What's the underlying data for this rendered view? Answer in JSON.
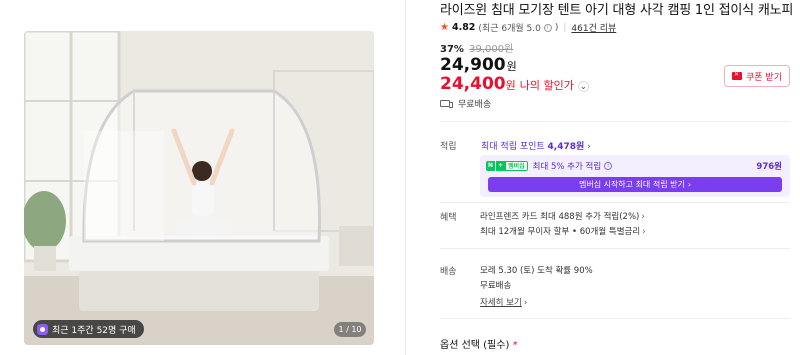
{
  "gallery": {
    "buy_badge": "최근 1주간 52명 구매",
    "pager": "1 / 10"
  },
  "product": {
    "title": "라이즈윈 침대 모기장 텐트 아기 대형 사각 캠핑 1인 접이식 캐노피",
    "rating": "4.82",
    "rating_sub": "(최근 6개월 5.0",
    "rating_sub_close": ")",
    "reviews": "461건 리뷰",
    "discount_pct": "37%",
    "original_price": "39,000원",
    "price": "24,900",
    "price_unit": "원",
    "my_price": "24,400",
    "my_price_unit": "원",
    "my_price_label": "나의 할인가",
    "coupon_label": "쿠폰 받기",
    "free_ship": "무료배송"
  },
  "points": {
    "label": "적립",
    "link_prefix": "최대 적립 포인트 ",
    "link_value": "4,478원",
    "np_n": "N",
    "np_plus": "+",
    "np_member": "멤버십",
    "member_text": "최대 5% 추가 적립",
    "member_amount": "976원",
    "member_button": "멤버십 시작하고 최대 적립 받기"
  },
  "benefit": {
    "label": "혜택",
    "line1": "라인프렌즈 카드 최대 488원 추가 적립(2%)",
    "line2": "최대 12개월 무이자 할부 • 60개월 특별금리"
  },
  "shipping": {
    "label": "배송",
    "line1": "모레 5.30 (토) 도착 확률 90%",
    "line2": "무료배송",
    "detail_link": "자세히 보기"
  },
  "option": {
    "title": "옵션 선택 (필수)",
    "required_mark": "*"
  },
  "colors": {
    "sale_red": "#e8112d",
    "member_purple": "#7b3df0",
    "naver_green": "#03c75a"
  }
}
